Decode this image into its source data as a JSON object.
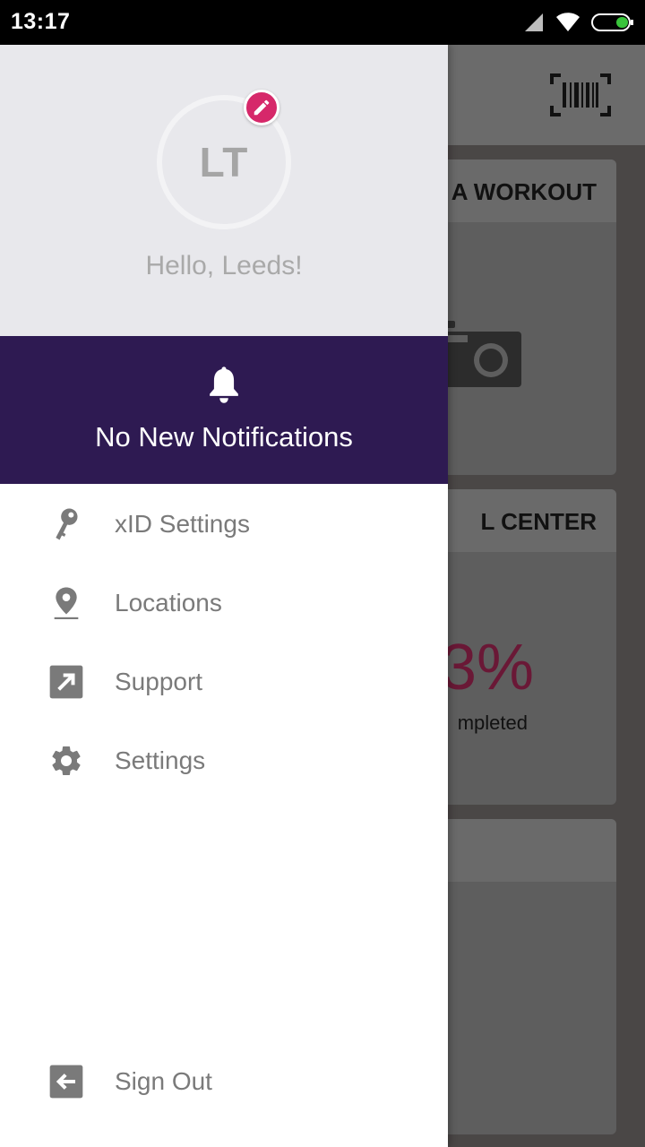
{
  "status_bar": {
    "time": "13:17",
    "icons": [
      "signal-icon",
      "wifi-icon",
      "battery-icon"
    ]
  },
  "background_app": {
    "toolbar_icon": "barcode-scanner-icon",
    "cards": [
      {
        "header": "A WORKOUT",
        "icon": "camera-icon"
      },
      {
        "header": "L CENTER",
        "percent": "3%",
        "caption": "mpleted"
      },
      {
        "header": ""
      }
    ],
    "accent_color": "#6a1836"
  },
  "drawer": {
    "profile": {
      "initials": "LT",
      "greeting": "Hello, Leeds!",
      "edit_icon": "pencil-icon",
      "badge_color": "#d6286a"
    },
    "notifications": {
      "icon": "bell-icon",
      "text": "No New Notifications",
      "background": "#2e1a52"
    },
    "menu": [
      {
        "label": "xID Settings",
        "icon": "key-icon"
      },
      {
        "label": "Locations",
        "icon": "location-pin-icon"
      },
      {
        "label": "Support",
        "icon": "external-link-icon"
      },
      {
        "label": "Settings",
        "icon": "gear-icon"
      }
    ],
    "sign_out": {
      "label": "Sign Out",
      "icon": "sign-out-icon"
    }
  }
}
